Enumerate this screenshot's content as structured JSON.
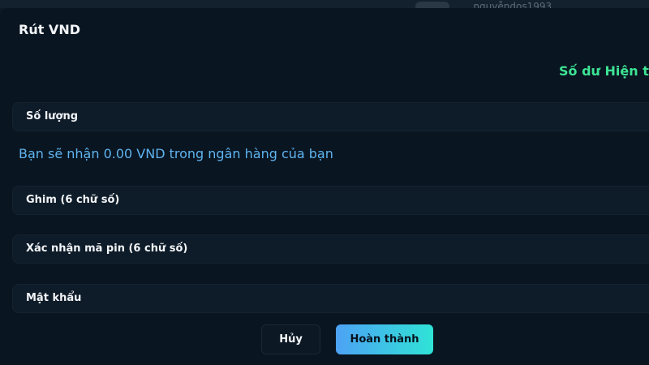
{
  "backdrop": {
    "username": "...nguyễndos1993"
  },
  "modal": {
    "title": "Rút VND",
    "balance_label": "Số dư Hiện tại:",
    "receive_note": "Bạn sẽ nhận 0.00 VND trong ngân hàng của bạn"
  },
  "form": {
    "amount_label": "Số lượng",
    "pin_label": "Ghim (6 chữ số)",
    "confirm_pin_label": "Xác nhận mã pin (6 chữ số)",
    "password_label": "Mật khẩu"
  },
  "actions": {
    "cancel_label": "Hủy",
    "submit_label": "Hoàn thành"
  },
  "colors": {
    "background": "#091521",
    "balance": "#3ee394",
    "note": "#5fb4f0",
    "button_gradient_start": "#4da2f5",
    "button_gradient_end": "#2fe3d6"
  }
}
